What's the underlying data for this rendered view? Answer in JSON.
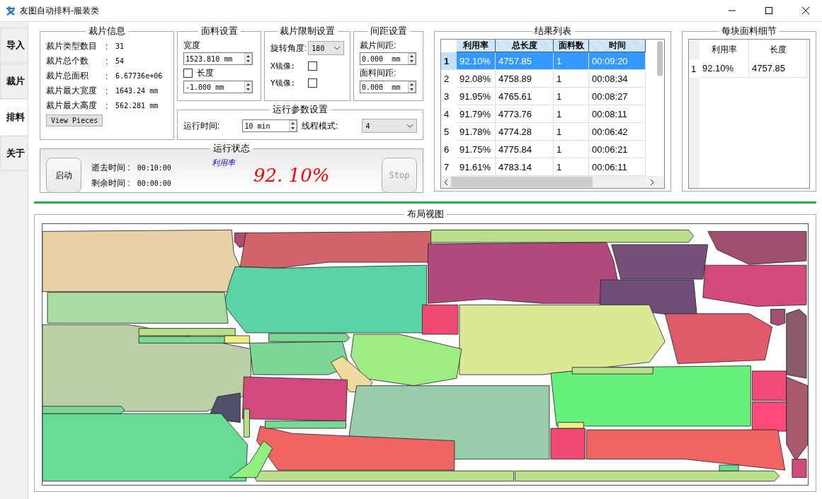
{
  "window": {
    "title": "友图自动排料-服装类"
  },
  "tabs": [
    {
      "label": "导入",
      "selected": false
    },
    {
      "label": "裁片",
      "selected": false
    },
    {
      "label": "排料",
      "selected": true
    },
    {
      "label": "关于",
      "selected": false
    }
  ],
  "piece_info": {
    "title": "裁片信息",
    "rows": [
      {
        "label": "裁片类型数目",
        "sep": ":",
        "value": "31"
      },
      {
        "label": "裁片总个数",
        "sep": ":",
        "value": "54"
      },
      {
        "label": "裁片总面积",
        "sep": ":",
        "value": "6.67736e+06"
      },
      {
        "label": "裁片最大宽度",
        "sep": ":",
        "value": "1643.24 mm"
      },
      {
        "label": "裁片最大高度",
        "sep": ":",
        "value": "562.281 mm"
      }
    ],
    "button": "View Pieces"
  },
  "fabric": {
    "title": "面料设置",
    "width_label": "宽度",
    "width_value": "1523.810 mm",
    "length": {
      "label": "长度",
      "checked": false
    },
    "length_value": "-1.000 mm"
  },
  "limits": {
    "title": "裁片限制设置",
    "rotation_label": "旋转角度:",
    "rotation_value": "180",
    "mirrors": [
      {
        "label": "X镜像:",
        "checked": false
      },
      {
        "label": "Y镜像:",
        "checked": false
      }
    ]
  },
  "spacing": {
    "title": "间距设置",
    "piece_label": "裁片间距:",
    "piece_value": "0.000  mm",
    "fabric_label": "面料间距:",
    "fabric_value": "0.000  mm"
  },
  "run_params": {
    "title": "运行参数设置",
    "time_label": "运行时间:",
    "time_value": "10 min",
    "thread_label": "线程模式:",
    "thread_value": "4"
  },
  "run_status": {
    "title": "运行状态",
    "start_button": "启动",
    "elapsed_label": "逝去时间 :",
    "elapsed_value": "00:10:00",
    "remaining_label": "剩余时间 :",
    "remaining_value": "00:00:00",
    "rate_label": "利用率",
    "rate_value": "92. 10%",
    "stop_button": {
      "label": "Stop",
      "disabled": true
    }
  },
  "results": {
    "title": "结果列表",
    "columns": [
      "利用率",
      "总长度",
      "面料数",
      "时间"
    ],
    "rows": [
      {
        "index": "1",
        "cells": [
          "92.10%",
          "4757.85",
          "1",
          "00:09:20"
        ],
        "selected": true
      },
      {
        "index": "2",
        "cells": [
          "92.08%",
          "4758.89",
          "1",
          "00:08:34"
        ],
        "selected": false
      },
      {
        "index": "3",
        "cells": [
          "91.95%",
          "4765.61",
          "1",
          "00:08:27"
        ],
        "selected": false
      },
      {
        "index": "4",
        "cells": [
          "91.79%",
          "4773.76",
          "1",
          "00:08:11"
        ],
        "selected": false
      },
      {
        "index": "5",
        "cells": [
          "91.78%",
          "4774.28",
          "1",
          "00:06:42"
        ],
        "selected": false
      },
      {
        "index": "6",
        "cells": [
          "91.75%",
          "4775.84",
          "1",
          "00:06:21"
        ],
        "selected": false
      },
      {
        "index": "7",
        "cells": [
          "91.61%",
          "4783.14",
          "1",
          "00:06:11"
        ],
        "selected": false
      }
    ]
  },
  "detail": {
    "title": "每块面料细节",
    "columns": [
      "利用率",
      "长度"
    ],
    "rows": [
      {
        "index": "1",
        "cells": [
          "92.10%",
          "4757.85"
        ]
      }
    ]
  },
  "layout_view": {
    "title": "布局视图"
  }
}
